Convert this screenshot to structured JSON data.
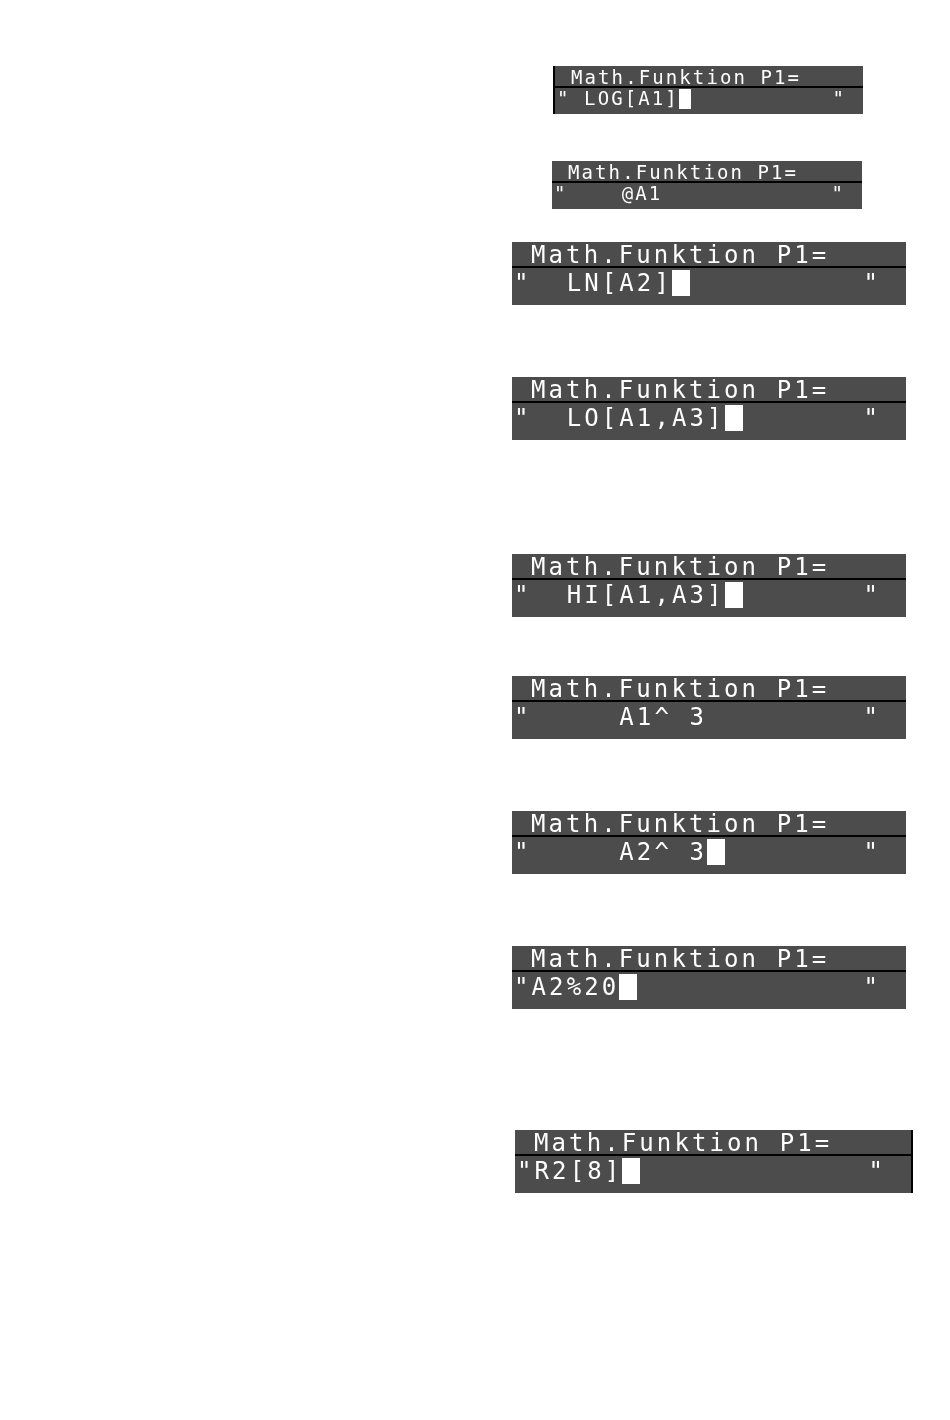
{
  "displays": [
    {
      "kind": "compact",
      "title": "Math.Funktion P1=",
      "open_quote": "\"",
      "expression": " LOG[A1]",
      "cursor": true,
      "close_quote": "\""
    },
    {
      "kind": "compact",
      "title": "Math.Funktion P1=",
      "open_quote": "\"",
      "expression": "    @A1",
      "cursor": false,
      "close_quote": "\""
    },
    {
      "kind": "standard",
      "title": "Math.Funktion P1=",
      "open_quote": "\"",
      "expression": "  LN[A2]",
      "cursor": true,
      "close_quote": "\""
    },
    {
      "kind": "standard",
      "title": "Math.Funktion P1=",
      "open_quote": "\"",
      "expression": "  LO[A1,A3]",
      "cursor": true,
      "close_quote": "\""
    },
    {
      "kind": "standard",
      "title": "Math.Funktion P1=",
      "open_quote": "\"",
      "expression": "  HI[A1,A3]",
      "cursor": true,
      "close_quote": "\""
    },
    {
      "kind": "standard",
      "title": "Math.Funktion P1=",
      "open_quote": "\"",
      "expression": "     A1^ 3",
      "cursor": false,
      "close_quote": "\""
    },
    {
      "kind": "standard",
      "title": "Math.Funktion P1=",
      "open_quote": "\"",
      "expression": "     A2^ 3",
      "cursor": true,
      "close_quote": "\""
    },
    {
      "kind": "standard",
      "title": "Math.Funktion P1=",
      "open_quote": "\"",
      "expression": "A2%20",
      "cursor": true,
      "close_quote": "\""
    },
    {
      "kind": "standard",
      "title": "Math.Funktion P1=",
      "open_quote": "\"",
      "expression": "R2[8]",
      "cursor": true,
      "close_quote": "\""
    }
  ]
}
